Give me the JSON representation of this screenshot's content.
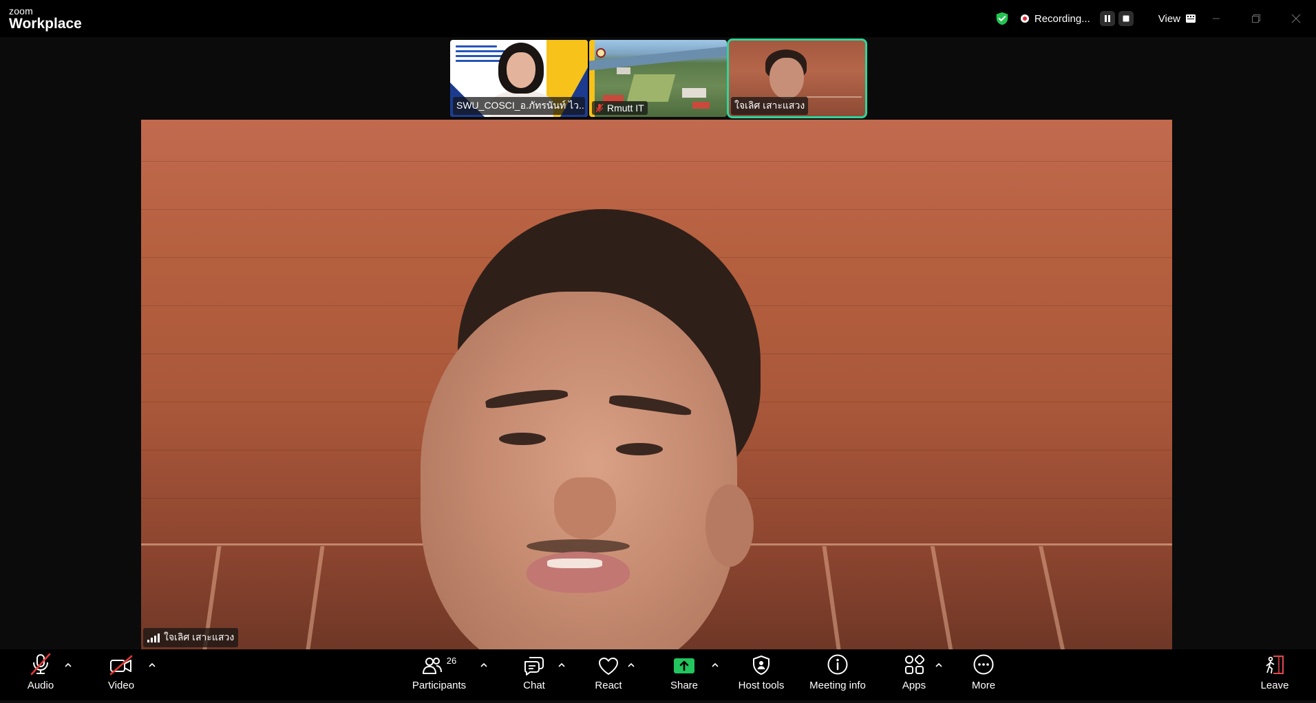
{
  "app": {
    "brand_top": "zoom",
    "brand_name": "Workplace"
  },
  "recording": {
    "label": "Recording..."
  },
  "view": {
    "label": "View"
  },
  "thumbnails": [
    {
      "name": "SWU_COSCI_อ.ภัทรนันท์ ไว..."
    },
    {
      "name": "Rmutt IT"
    },
    {
      "name": "ใจเลิศ เสาะแสวง"
    }
  ],
  "main_video": {
    "name": "ใจเลิศ เสาะแสวง"
  },
  "toolbar": {
    "audio": "Audio",
    "video": "Video",
    "participants": "Participants",
    "participants_count": "26",
    "chat": "Chat",
    "react": "React",
    "share": "Share",
    "host_tools": "Host tools",
    "meeting_info": "Meeting info",
    "apps": "Apps",
    "more": "More",
    "leave": "Leave"
  },
  "colors": {
    "accent_green": "#2fd59b",
    "share_green": "#22c55e",
    "muted_red": "#e53935",
    "leave_red": "#e5484d"
  }
}
